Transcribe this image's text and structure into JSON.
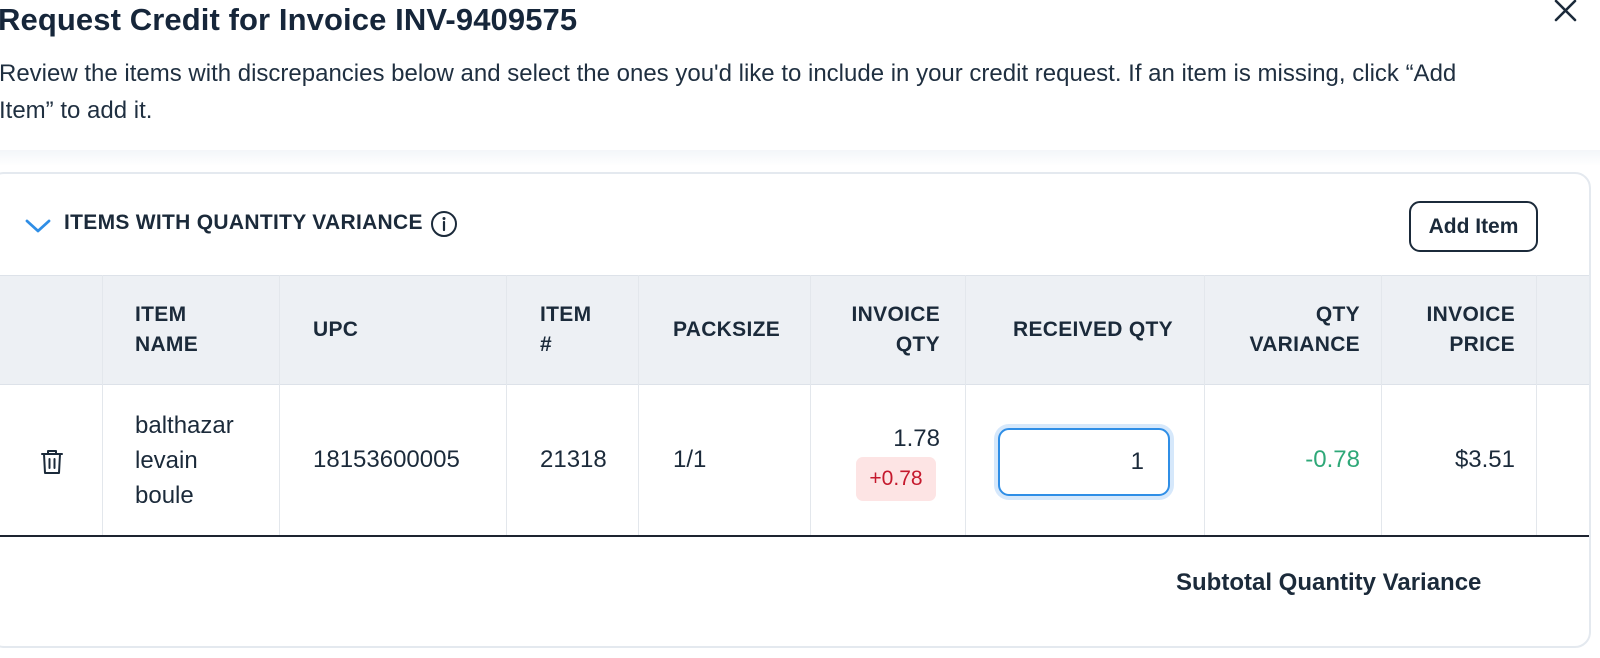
{
  "dialog": {
    "title": "Request Credit for Invoice INV-9409575",
    "description": "Review the items with discrepancies below and select the ones you'd like to include in your credit request. If an item is missing, click “Add Item” to add it.",
    "close_icon": "close-icon"
  },
  "section": {
    "title": "ITEMS WITH QUANTITY VARIANCE",
    "add_item_label": "Add Item",
    "chevron_icon": "chevron-down-icon",
    "info_icon": "info-icon",
    "accent_color": "#2f8ee6"
  },
  "table": {
    "columns": {
      "item_name": [
        "ITEM",
        "NAME"
      ],
      "upc": "UPC",
      "item_no": [
        "ITEM",
        "#"
      ],
      "packsize": "PACKSIZE",
      "invoice_qty": [
        "INVOICE",
        "QTY"
      ],
      "received_qty": "RECEIVED QTY",
      "qty_variance": [
        "QTY",
        "VARIANCE"
      ],
      "invoice_price": [
        "INVOICE",
        "PRICE"
      ]
    },
    "rows": [
      {
        "delete_icon": "trash-icon",
        "item_name": [
          "balthazar",
          "levain",
          "boule"
        ],
        "upc": "18153600005",
        "item_no": "21318",
        "packsize": "1/1",
        "invoice_qty": "1.78",
        "invoice_qty_badge": "+0.78",
        "received_qty": "1",
        "qty_variance": "-0.78",
        "invoice_price": "$3.51"
      }
    ]
  },
  "footer": {
    "subtotal_label": "Subtotal Quantity Variance"
  },
  "colors": {
    "positive_variance": "#2ea878",
    "badge_text": "#c5192d",
    "badge_bg": "#fde4e4",
    "header_bg": "#edf0f4"
  }
}
